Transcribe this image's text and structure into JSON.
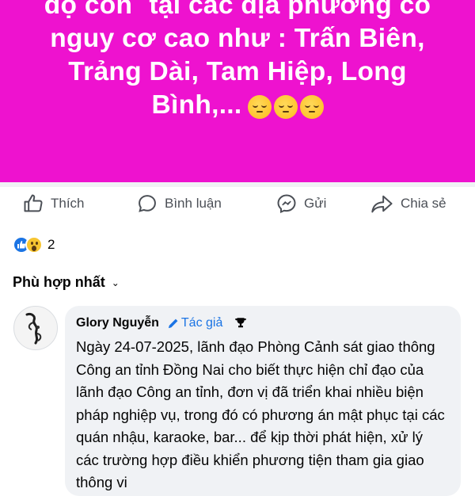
{
  "post": {
    "banner_lines": [
      "độ cồn` tại các địa phương có",
      "nguy cơ cao như : Trấn Biên,",
      "Trảng Dài, Tam Hiệp, Long",
      "Bình,..."
    ],
    "banner_emoji": [
      "pensive-face",
      "pensive-face",
      "pensive-face"
    ],
    "banner_color": "#ee12cf"
  },
  "actions": {
    "like": "Thích",
    "comment": "Bình luận",
    "send": "Gửi",
    "share": "Chia sẻ"
  },
  "reactions": {
    "types": [
      "like",
      "wow"
    ],
    "count": "2"
  },
  "comments_sort": {
    "label": "Phù hợp nhất"
  },
  "comment": {
    "author": "Glory Nguyễn",
    "badge": "Tác giả",
    "text": "Ngày 24-07-2025, lãnh đạo Phòng Cảnh sát giao thông Công an tỉnh Đồng Nai cho biết thực hiện chỉ đạo của lãnh đạo Công an tỉnh, đơn vị đã triển khai nhiều biện pháp nghiệp vụ, trong đó có phương án mật phục tại các quán nhậu, karaoke, bar... để kịp thời phát hiện, xử lý các trường hợp điều khiển phương tiện tham gia giao thông vi"
  }
}
